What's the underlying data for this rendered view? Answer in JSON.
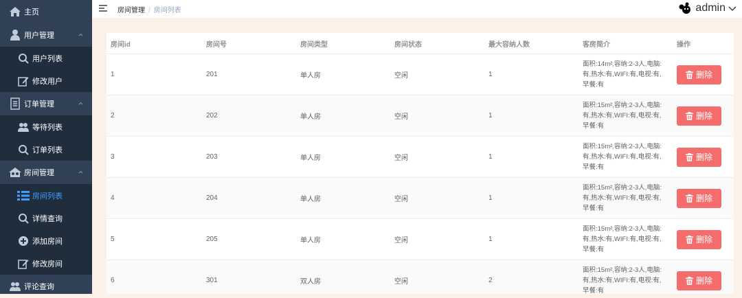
{
  "sidebar": {
    "home": "主页",
    "user_mgmt": "用户管理",
    "user_list": "用户列表",
    "edit_user": "修改用户",
    "order_mgmt": "订单管理",
    "waiting_list": "等待列表",
    "order_list": "订单列表",
    "room_mgmt": "房间管理",
    "room_list": "房间列表",
    "detail_query": "详情查询",
    "add_room": "添加房间",
    "edit_room": "修改房间",
    "comment_query": "评论查询"
  },
  "header": {
    "breadcrumb_parent": "房间管理",
    "breadcrumb_sep": "/",
    "breadcrumb_current": "房间列表",
    "username": "admin"
  },
  "table": {
    "headers": [
      "房间id",
      "房间号",
      "房间类型",
      "房间状态",
      "最大容纳人数",
      "客房简介",
      "操作"
    ],
    "delete_label": "删除",
    "rows": [
      {
        "id": "1",
        "number": "201",
        "type": "单人房",
        "status": "空闲",
        "capacity": "1",
        "desc": "面积:14m²,容纳:2-3人,电脑:有,热水:有,WIFI:有,电视:有,早餐:有"
      },
      {
        "id": "2",
        "number": "202",
        "type": "单人房",
        "status": "空闲",
        "capacity": "1",
        "desc": "面积:15m²,容纳:2-3人,电脑:有,热水:有,WIFI:有,电视:有,早餐:有"
      },
      {
        "id": "3",
        "number": "203",
        "type": "单人房",
        "status": "空闲",
        "capacity": "1",
        "desc": "面积:15m²,容纳:2-3人,电脑:有,热水:有,WIFI:有,电视:有,早餐:有"
      },
      {
        "id": "4",
        "number": "204",
        "type": "单人房",
        "status": "空闲",
        "capacity": "1",
        "desc": "面积:15m²,容纳:2-3人,电脑:有,热水:有,WIFI:有,电视:有,早餐:有"
      },
      {
        "id": "5",
        "number": "205",
        "type": "单人房",
        "status": "空闲",
        "capacity": "1",
        "desc": "面积:15m²,容纳:2-3人,电脑:有,热水:有,WIFI:有,电视:有,早餐:有"
      },
      {
        "id": "6",
        "number": "301",
        "type": "双人房",
        "status": "空闲",
        "capacity": "2",
        "desc": "面积:15m²,容纳:2-3人,电脑:有,热水:有,WIFI:有,电视:有,早餐:有"
      }
    ]
  },
  "colors": {
    "sidebar_bg": "#304156",
    "submenu_bg": "#1f2d3d",
    "active": "#409eff",
    "danger": "#f56c6c",
    "page_bg": "#fbf1e8"
  }
}
